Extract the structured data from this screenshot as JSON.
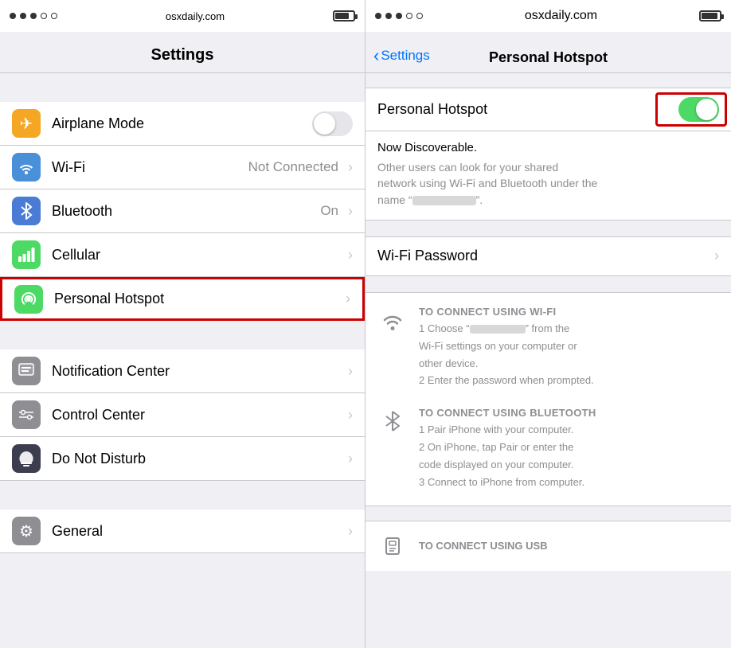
{
  "left": {
    "statusBar": {
      "url": "osxdaily.com"
    },
    "pageTitle": "Settings",
    "items": [
      {
        "id": "airplane",
        "icon": "✈",
        "iconClass": "icon-orange",
        "label": "Airplane Mode",
        "value": "",
        "hasToggle": true,
        "hasChevron": false
      },
      {
        "id": "wifi",
        "icon": "wifi",
        "iconClass": "icon-blue",
        "label": "Wi-Fi",
        "value": "Not Connected",
        "hasToggle": false,
        "hasChevron": true
      },
      {
        "id": "bluetooth",
        "icon": "bt",
        "iconClass": "icon-blue2",
        "label": "Bluetooth",
        "value": "On",
        "hasToggle": false,
        "hasChevron": true
      },
      {
        "id": "cellular",
        "icon": "cell",
        "iconClass": "icon-green",
        "label": "Cellular",
        "value": "",
        "hasToggle": false,
        "hasChevron": true
      },
      {
        "id": "hotspot",
        "icon": "hs",
        "iconClass": "icon-green",
        "label": "Personal Hotspot",
        "value": "",
        "hasToggle": false,
        "hasChevron": true,
        "highlighted": true
      }
    ],
    "section2": [
      {
        "id": "notification",
        "icon": "notif",
        "iconClass": "icon-gray",
        "label": "Notification Center",
        "hasChevron": true
      },
      {
        "id": "control",
        "icon": "ctrl",
        "iconClass": "icon-gray",
        "label": "Control Center",
        "hasChevron": true
      },
      {
        "id": "dnd",
        "icon": "dnd",
        "iconClass": "icon-dark",
        "label": "Do Not Disturb",
        "hasChevron": true
      }
    ],
    "section3": [
      {
        "id": "general",
        "icon": "⚙",
        "iconClass": "icon-gray",
        "label": "General",
        "hasChevron": true
      }
    ]
  },
  "right": {
    "statusBar": {
      "url": "osxdaily.com"
    },
    "backLabel": "Settings",
    "pageTitle": "Personal Hotspot",
    "hotspotLabel": "Personal Hotspot",
    "hotspotEnabled": true,
    "discoverableTitle": "Now Discoverable.",
    "discoverableDesc1": "Other users can look for your shared",
    "discoverableDesc2": "network using Wi-Fi and Bluetooth under the",
    "discoverableDesc3": "name “",
    "discoverableDesc4": "”.",
    "wifiPasswordLabel": "Wi-Fi Password",
    "wifiInstr": {
      "title": "TO CONNECT USING WI-FI",
      "step1a": "1 Choose “",
      "step1b": "” from the",
      "step1c": "Wi-Fi settings on your computer or",
      "step1d": "other device.",
      "step2": "2 Enter the password when prompted."
    },
    "btInstr": {
      "title": "TO CONNECT USING BLUETOOTH",
      "step1": "1 Pair iPhone with your computer.",
      "step2": "2 On iPhone, tap Pair or enter the",
      "step2b": "code displayed on your computer.",
      "step3": "3 Connect to iPhone from computer."
    },
    "usbInstr": {
      "title": "TO CONNECT USING USB"
    }
  }
}
